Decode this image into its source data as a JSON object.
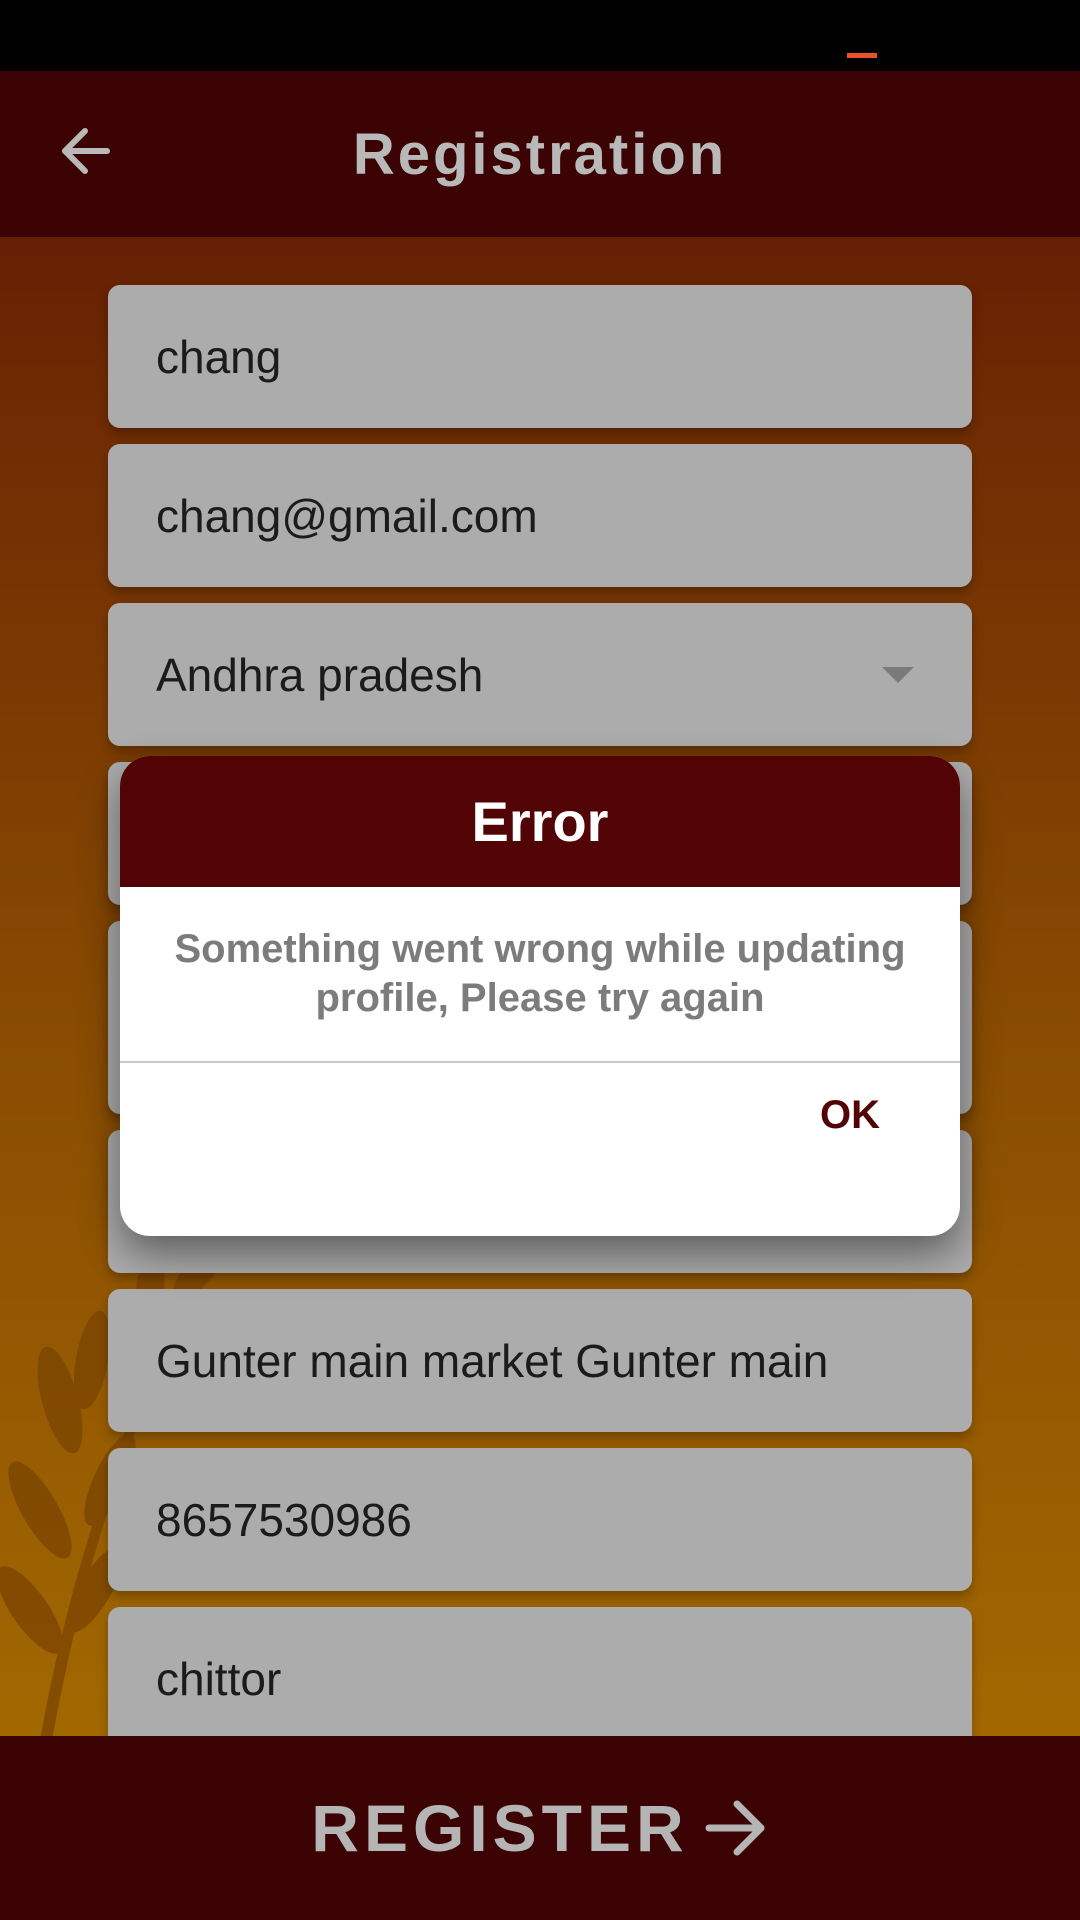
{
  "status_bar": {
    "indicator_color": "#e8512a"
  },
  "app_bar": {
    "back_icon": "arrow-left-icon",
    "title": "Registration"
  },
  "form": {
    "fields": [
      {
        "name": "name",
        "value": "chang"
      },
      {
        "name": "email",
        "value": "chang@gmail.com"
      },
      {
        "name": "state",
        "value": "Andhra pradesh",
        "dropdown": true
      },
      {
        "name": "district",
        "value": "",
        "dropdown": true
      },
      {
        "name": "address-1",
        "value": ""
      },
      {
        "name": "pincode",
        "value": ""
      },
      {
        "name": "address-2",
        "value": "Gunter main market Gunter main"
      },
      {
        "name": "phone",
        "value": "8657530986"
      },
      {
        "name": "city",
        "value": "chittor"
      }
    ]
  },
  "bottom_bar": {
    "register_label": "REGISTER",
    "register_icon": "arrow-right-icon"
  },
  "dialog": {
    "title": "Error",
    "message": "Something went wrong while updating profile, Please try again",
    "ok_label": "OK"
  },
  "colors": {
    "app_bar_bg": "#3b0304",
    "dialog_header_bg": "#520306",
    "field_bg": "#acacac"
  }
}
